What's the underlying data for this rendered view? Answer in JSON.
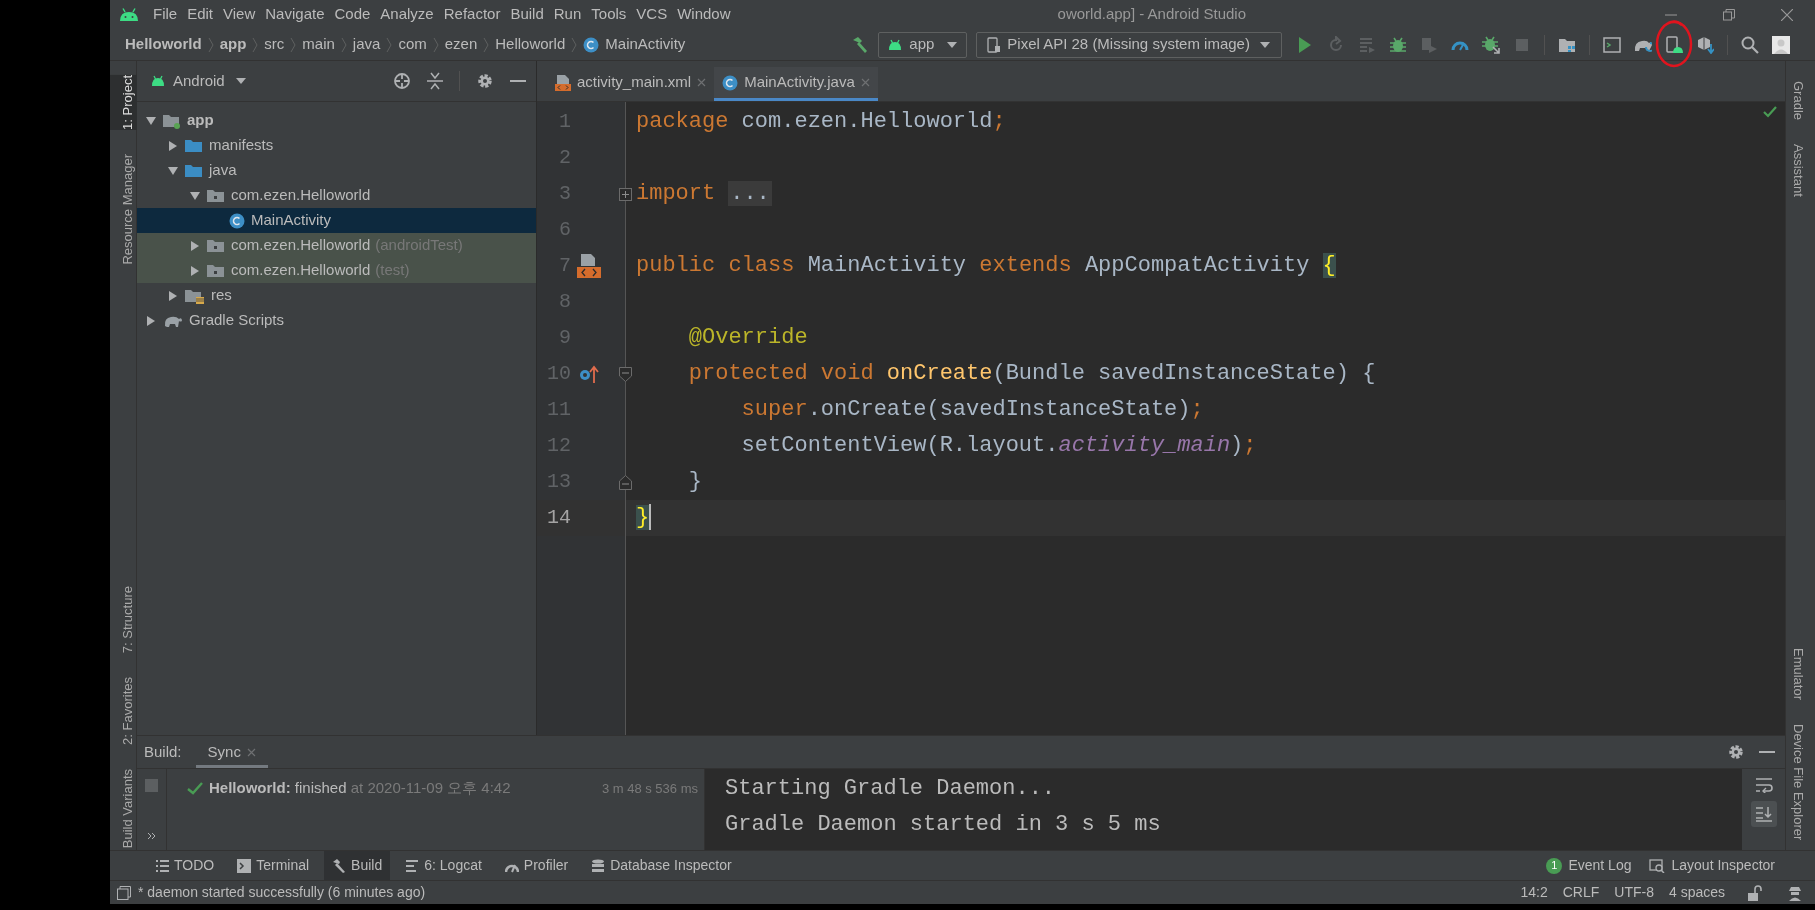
{
  "window": {
    "title": "oworld.app] - Android Studio"
  },
  "menu": [
    "File",
    "Edit",
    "View",
    "Navigate",
    "Code",
    "Analyze",
    "Refactor",
    "Build",
    "Run",
    "Tools",
    "VCS",
    "Window"
  ],
  "breadcrumbs": [
    {
      "label": "Helloworld",
      "bold": true,
      "kind": "plain"
    },
    {
      "label": "app",
      "bold": true,
      "kind": "plain"
    },
    {
      "label": "src",
      "bold": false,
      "kind": "plain"
    },
    {
      "label": "main",
      "bold": false,
      "kind": "plain"
    },
    {
      "label": "java",
      "bold": false,
      "kind": "plain"
    },
    {
      "label": "com",
      "bold": false,
      "kind": "plain"
    },
    {
      "label": "ezen",
      "bold": false,
      "kind": "plain"
    },
    {
      "label": "Helloworld",
      "bold": false,
      "kind": "plain"
    },
    {
      "label": "MainActivity",
      "bold": false,
      "kind": "class"
    }
  ],
  "toolbar": {
    "configuration": "app",
    "device": "Pixel API 28 (Missing system image)"
  },
  "left_stripe": {
    "top": [
      {
        "label": "1: Project",
        "selected": true
      },
      {
        "label": "Resource Manager",
        "selected": false
      }
    ],
    "bottom": [
      {
        "label": "7: Structure",
        "selected": false
      },
      {
        "label": "2: Favorites",
        "selected": false
      },
      {
        "label": "Build Variants",
        "selected": false
      }
    ]
  },
  "right_stripe": {
    "top": [
      {
        "label": "Gradle"
      },
      {
        "label": "Assistant"
      }
    ],
    "bottom": [
      {
        "label": "Emulator"
      },
      {
        "label": "Device File Explorer"
      }
    ]
  },
  "project_panel": {
    "view": "Android",
    "tree": [
      {
        "label": "app",
        "kind": "module",
        "expanded": true,
        "selected": false,
        "children": [
          {
            "label": "manifests",
            "kind": "folder",
            "expanded": false,
            "selected": false
          },
          {
            "label": "java",
            "kind": "folder",
            "expanded": true,
            "selected": false,
            "children": [
              {
                "label": "com.ezen.Helloworld",
                "kind": "package",
                "expanded": true,
                "selected": false,
                "children": [
                  {
                    "label": "MainActivity",
                    "kind": "class",
                    "selected": true
                  }
                ]
              },
              {
                "label": "com.ezen.Helloworld",
                "suffix": "(androidTest)",
                "kind": "test_package",
                "expanded": false,
                "selected": false
              },
              {
                "label": "com.ezen.Helloworld",
                "suffix": "(test)",
                "kind": "test_package",
                "expanded": false,
                "selected": false
              }
            ]
          },
          {
            "label": "res",
            "kind": "res",
            "expanded": false,
            "selected": false
          }
        ]
      },
      {
        "label": "Gradle Scripts",
        "kind": "gradle",
        "expanded": false,
        "selected": false
      }
    ]
  },
  "editor": {
    "tabs": [
      {
        "label": "activity_main.xml",
        "kind": "xml",
        "selected": false
      },
      {
        "label": "MainActivity.java",
        "kind": "class",
        "selected": true
      }
    ],
    "lines": [
      {
        "number": "1",
        "current": false,
        "tokens": [
          {
            "text": "package",
            "kind": "keyword"
          },
          {
            "text": " com.ezen.Helloworld",
            "kind": "plain"
          },
          {
            "text": ";",
            "kind": "keyword"
          }
        ]
      },
      {
        "number": "2",
        "current": false
      },
      {
        "number": "3",
        "current": false,
        "fold": {
          "kind": "expand"
        },
        "tokens": [
          {
            "text": "import",
            "kind": "keyword"
          },
          {
            "text": "...",
            "kind": "folded"
          }
        ]
      },
      {
        "number": "6",
        "current": false
      },
      {
        "number": "7",
        "current": false,
        "gutter": {
          "kind": "layout"
        },
        "tokens": [
          {
            "text": "public class ",
            "kind": "keyword"
          },
          {
            "text": "MainActivity ",
            "kind": "plain"
          },
          {
            "text": "extends ",
            "kind": "keyword"
          },
          {
            "text": "AppCompatActivity ",
            "kind": "plain"
          },
          {
            "text": "{",
            "kind": "brace"
          }
        ]
      },
      {
        "number": "8",
        "current": false
      },
      {
        "number": "9",
        "current": false,
        "tokens": [
          {
            "text": "    @Override",
            "kind": "annotation"
          }
        ]
      },
      {
        "number": "10",
        "current": false,
        "gutter": {
          "kind": "override"
        },
        "fold": {
          "kind": "start"
        },
        "tokens": [
          {
            "text": "    protected void ",
            "kind": "keyword"
          },
          {
            "text": "onCreate",
            "kind": "method"
          },
          {
            "text": "(Bundle savedInstanceState) {",
            "kind": "plain"
          }
        ]
      },
      {
        "number": "11",
        "current": false,
        "tokens": [
          {
            "text": "        super",
            "kind": "keyword"
          },
          {
            "text": ".onCreate(savedInstanceState)",
            "kind": "plain"
          },
          {
            "text": ";",
            "kind": "keyword"
          }
        ]
      },
      {
        "number": "12",
        "current": false,
        "tokens": [
          {
            "text": "        setContentView(R.layout.",
            "kind": "plain"
          },
          {
            "text": "activity_main",
            "kind": "field"
          },
          {
            "text": ")",
            "kind": "plain"
          },
          {
            "text": ";",
            "kind": "keyword"
          }
        ]
      },
      {
        "number": "13",
        "current": false,
        "fold": {
          "kind": "end"
        },
        "tokens": [
          {
            "text": "    }",
            "kind": "plain"
          }
        ]
      },
      {
        "number": "14",
        "current": true,
        "tokens": [
          {
            "text": "}",
            "kind": "brace"
          }
        ]
      }
    ]
  },
  "build": {
    "label": "Build:",
    "tabs": [
      {
        "label": "Sync",
        "selected": true
      }
    ],
    "result": {
      "name": "Helloworld:",
      "status": "finished",
      "time": "at 2020-11-09 오후 4:42",
      "duration": "3 m 48 s 536 ms"
    },
    "console": [
      "Starting Gradle Daemon...",
      "Gradle Daemon started in 3 s 5 ms"
    ]
  },
  "tool_windows": [
    {
      "label": "TODO",
      "kind": "todo",
      "selected": false
    },
    {
      "label": "Terminal",
      "kind": "terminal",
      "selected": false
    },
    {
      "label": "Build",
      "kind": "build",
      "selected": true
    },
    {
      "label": "6: Logcat",
      "kind": "logcat",
      "selected": false
    },
    {
      "label": "Profiler",
      "kind": "profiler",
      "selected": false
    },
    {
      "label": "Database Inspector",
      "kind": "database",
      "selected": false
    }
  ],
  "tool_windows_right": [
    {
      "label": "Event Log",
      "badge": "1"
    },
    {
      "label": "Layout Inspector"
    }
  ],
  "status_bar": {
    "message": "* daemon started successfully (6 minutes ago)",
    "items": [
      "14:2",
      "CRLF",
      "UTF-8",
      "4 spaces"
    ]
  }
}
